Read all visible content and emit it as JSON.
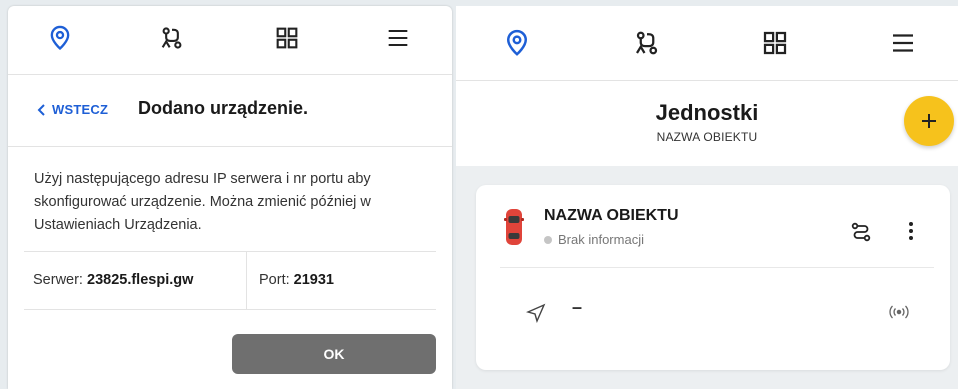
{
  "colors": {
    "accent_blue": "#1e5fd6",
    "fab_yellow": "#f6c21c",
    "ok_button": "#6f6f6f",
    "car_red": "#e0443a"
  },
  "left_panel": {
    "nav_icons": [
      "location-pin-icon",
      "route-icon",
      "grid-icon",
      "menu-icon"
    ],
    "back_label": "WSTECZ",
    "title": "Dodano urządzenie.",
    "description": "Użyj następującego adresu IP serwera i nr portu aby skonfigurować urządzenie. Można zmienić później w Ustawieniach Urządzenia.",
    "server_label": "Serwer: ",
    "server_value": "23825.flespi.gw",
    "port_label": "Port: ",
    "port_value": "21931",
    "ok_label": "OK"
  },
  "right_panel": {
    "nav_icons": [
      "location-pin-icon",
      "route-icon",
      "grid-icon",
      "menu-icon"
    ],
    "title": "Jednostki",
    "subtitle": "NAZWA OBIEKTU",
    "fab_icon": "plus-icon",
    "unit": {
      "name": "NAZWA OBIEKTU",
      "status": "Brak informacji",
      "speed": "–",
      "icons": [
        "car-icon",
        "route-settings-icon",
        "more-vert-icon",
        "navigation-arrow-icon",
        "signal-icon"
      ]
    }
  }
}
